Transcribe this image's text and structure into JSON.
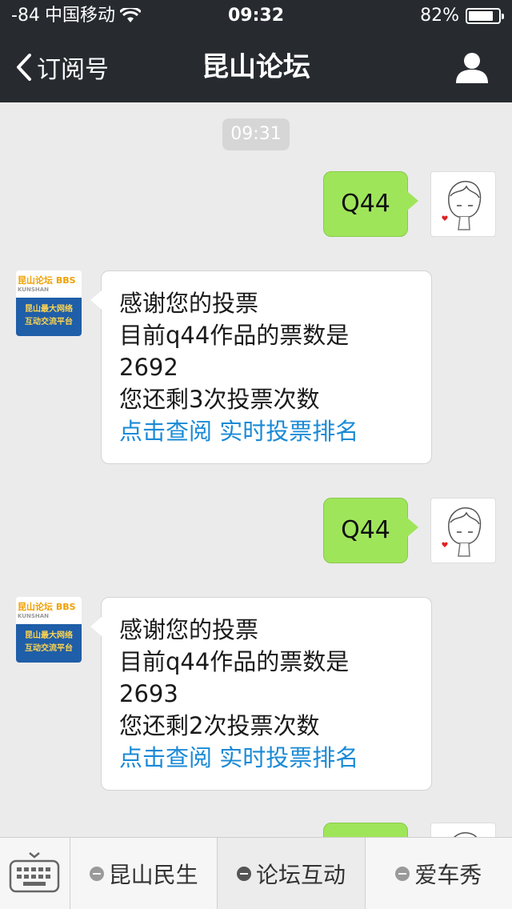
{
  "status_bar": {
    "signal": "-84",
    "carrier": "中国移动",
    "time": "09:32",
    "battery": "82%",
    "battery_level": 0.82
  },
  "nav": {
    "back_label": "订阅号",
    "title": "昆山论坛"
  },
  "chat": {
    "timestamp": "09:31",
    "bbs_avatar": {
      "top_text": "昆山论坛 BBS",
      "sub_text": "KUNSHAN",
      "bottom_line1": "昆山最大网络",
      "bottom_line2": "互动交流平台"
    },
    "messages": [
      {
        "from": "user",
        "text": "Q44"
      },
      {
        "from": "account",
        "lines": [
          "感谢您的投票",
          "目前q44作品的票数是",
          "2692",
          "您还剩3次投票次数"
        ],
        "link1": "点击查阅",
        "link2": "实时投票排名"
      },
      {
        "from": "user",
        "text": "Q44"
      },
      {
        "from": "account",
        "lines": [
          "感谢您的投票",
          "目前q44作品的票数是",
          "2693",
          "您还剩2次投票次数"
        ],
        "link1": "点击查阅",
        "link2": "实时投票排名"
      }
    ]
  },
  "bottom_menu": {
    "items": [
      "昆山民生",
      "论坛互动",
      "爱车秀"
    ]
  }
}
